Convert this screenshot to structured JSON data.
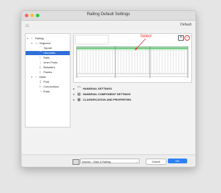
{
  "window": {
    "title": "Railing Default Settings",
    "traffic_lights": [
      "#ff5f57",
      "#febc2e",
      "#28c840"
    ],
    "default_label": "Default"
  },
  "tree": {
    "items": [
      {
        "label": "Railing",
        "icon": "railing-icon",
        "expander": "▾"
      },
      {
        "label": "Segment",
        "icon": "segment-icon",
        "expander": "▾"
      },
      {
        "label": "Toprail",
        "icon": "toprail-icon",
        "expander": ""
      },
      {
        "label": "Handrails",
        "icon": "handrails-icon",
        "expander": ""
      },
      {
        "label": "Rails",
        "icon": "rails-icon",
        "expander": ""
      },
      {
        "label": "Inner Posts",
        "icon": "inner-posts-icon",
        "expander": ""
      },
      {
        "label": "Balusters",
        "icon": "balusters-icon",
        "expander": ""
      },
      {
        "label": "Panels",
        "icon": "panels-icon",
        "expander": ""
      },
      {
        "label": "Node",
        "icon": "node-icon",
        "expander": "▾"
      },
      {
        "label": "Post",
        "icon": "post-icon",
        "expander": ""
      },
      {
        "label": "Connections",
        "icon": "connections-icon",
        "expander": ""
      },
      {
        "label": "Ends",
        "icon": "ends-icon",
        "expander": ""
      }
    ],
    "selected": "Handrails"
  },
  "preview": {
    "annotation": "Select",
    "add_symbol": "+",
    "remove_symbol": "−",
    "accent": "#e43030",
    "rail_color": "#3cba54"
  },
  "sections": [
    {
      "label": "HANDRAIL SETTINGS",
      "icon": "handrail-settings-icon"
    },
    {
      "label": "HANDRAIL COMPONENT SETTINGS",
      "icon": "component-settings-icon"
    },
    {
      "label": "CLASSIFICATION AND PROPERTIES",
      "icon": "classification-icon"
    }
  ],
  "footer": {
    "favorite": "Interior - Stair & Railing",
    "cancel": "Cancel",
    "ok": "OK",
    "ok_color": "#2f7ff5"
  }
}
